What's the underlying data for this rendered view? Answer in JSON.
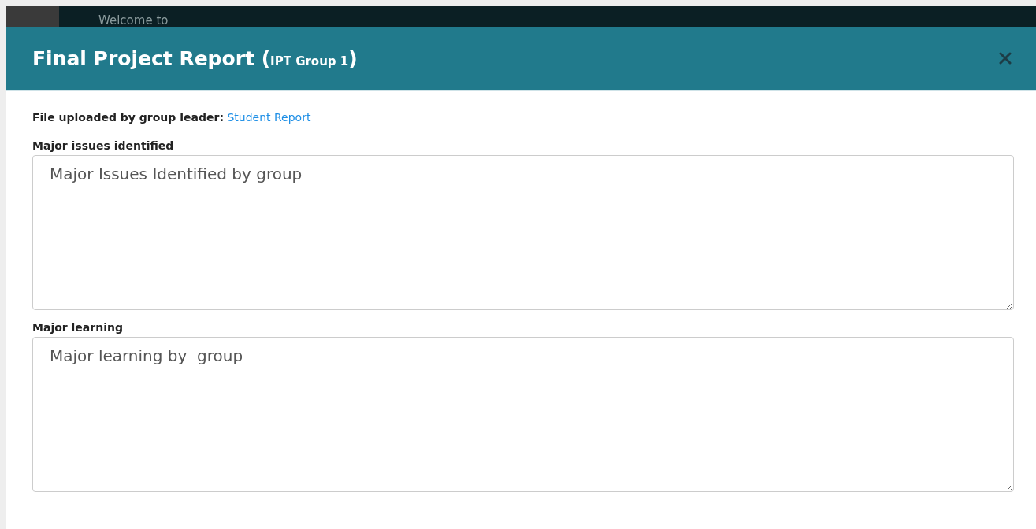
{
  "background": {
    "welcome_text": "Welcome to"
  },
  "modal": {
    "title": "Final Project Report (**IPT Group 1**)",
    "upload": {
      "label": "File uploaded by group leader:",
      "link": "Student Report"
    },
    "fields": [
      {
        "label": "Major issues identified",
        "value": "Major Issues Identified by group"
      },
      {
        "label": "Major learning",
        "value": "Major learning by  group"
      }
    ]
  }
}
